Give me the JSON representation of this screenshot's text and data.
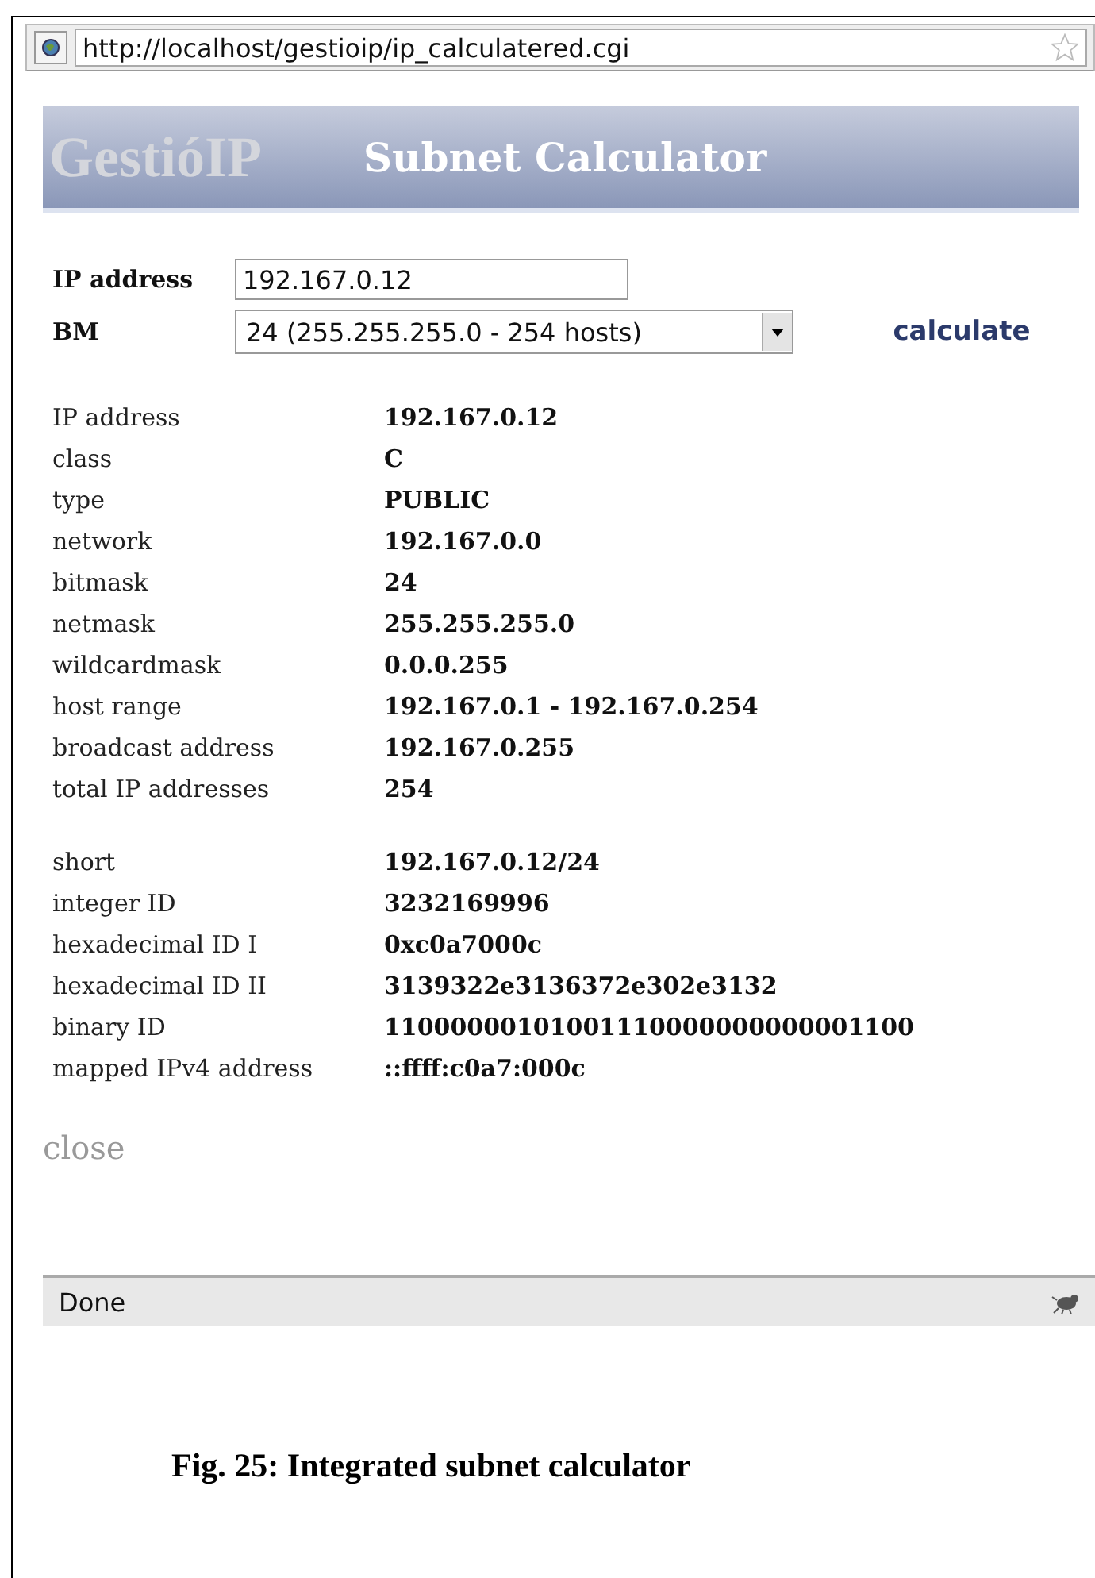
{
  "address_bar": {
    "url": "http://localhost/gestioip/ip_calculatered.cgi"
  },
  "header": {
    "logo": "GestióIP",
    "title": "Subnet Calculator"
  },
  "form": {
    "ip_label": "IP address",
    "ip_value": "192.167.0.12",
    "bm_label": "BM",
    "bm_value": "24 (255.255.255.0 - 254 hosts)",
    "submit": "calculate"
  },
  "results": [
    [
      {
        "label": "IP address",
        "value": "192.167.0.12"
      },
      {
        "label": "class",
        "value": "C"
      },
      {
        "label": "type",
        "value": "PUBLIC"
      },
      {
        "label": "network",
        "value": "192.167.0.0"
      },
      {
        "label": "bitmask",
        "value": "24"
      },
      {
        "label": "netmask",
        "value": "255.255.255.0"
      },
      {
        "label": "wildcardmask",
        "value": "0.0.0.255"
      },
      {
        "label": "host range",
        "value": "192.167.0.1 - 192.167.0.254"
      },
      {
        "label": "broadcast address",
        "value": "192.167.0.255"
      },
      {
        "label": "total IP addresses",
        "value": "254"
      }
    ],
    [
      {
        "label": "short",
        "value": "192.167.0.12/24"
      },
      {
        "label": "integer ID",
        "value": "3232169996"
      },
      {
        "label": "hexadecimal ID I",
        "value": "0xc0a7000c"
      },
      {
        "label": "hexadecimal ID II",
        "value": "3139322e3136372e302e3132"
      },
      {
        "label": "binary ID",
        "value": "11000000101001110000000000001100"
      },
      {
        "label": "mapped IPv4 address",
        "value": "::ffff:c0a7:000c"
      }
    ]
  ],
  "close_link": "close",
  "status_bar": {
    "text": "Done"
  },
  "caption": "Fig. 25: Integrated subnet calculator"
}
